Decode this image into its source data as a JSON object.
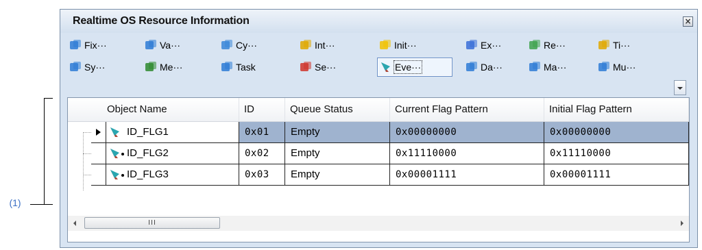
{
  "window": {
    "title": "Realtime OS Resource Information"
  },
  "callout": {
    "label": "(1)"
  },
  "toolbar": {
    "row1": [
      {
        "label": "Fix···",
        "icon": "fixed-memory-pool-icon",
        "color": "#2e7bd6"
      },
      {
        "label": "Va···",
        "icon": "variable-memory-pool-icon",
        "color": "#2e7bd6"
      },
      {
        "label": "Cy···",
        "icon": "cyclic-handler-icon",
        "color": "#3a86d8"
      },
      {
        "label": "Int···",
        "icon": "interrupt-handler-icon",
        "color": "#e0a800"
      },
      {
        "label": "Init···",
        "icon": "initialize-routine-icon",
        "color": "#f2c200"
      },
      {
        "label": "Ex···",
        "icon": "exception-handler-icon",
        "color": "#3a6fd8"
      },
      {
        "label": "Re···",
        "icon": "ready-queue-icon",
        "color": "#3fa34d"
      },
      {
        "label": "Ti···",
        "icon": "timer-queue-icon",
        "color": "#e0a800"
      }
    ],
    "row2": [
      {
        "label": "Sy···",
        "icon": "system-status-icon",
        "color": "#2e7bd6"
      },
      {
        "label": "Me···",
        "icon": "memory-icon",
        "color": "#2f8a2f"
      },
      {
        "label": "Task",
        "icon": "task-icon",
        "color": "#2e7bd6"
      },
      {
        "label": "Se···",
        "icon": "semaphore-icon",
        "color": "#d0342c"
      },
      {
        "label": "Eve···",
        "icon": "eventflag-icon",
        "color": "#1f9f9f"
      },
      {
        "label": "Da···",
        "icon": "data-queue-icon",
        "color": "#2e7bd6"
      },
      {
        "label": "Ma···",
        "icon": "mailbox-icon",
        "color": "#2e7bd6"
      },
      {
        "label": "Mu···",
        "icon": "mutex-icon",
        "color": "#2e7bd6"
      }
    ],
    "active_index": 4
  },
  "table": {
    "columns": [
      "Object Name",
      "ID",
      "Queue Status",
      "Current Flag Pattern",
      "Initial Flag Pattern"
    ],
    "rows": [
      {
        "name": "ID_FLG1",
        "id": "0x01",
        "queue": "Empty",
        "current": "0x00000000",
        "initial": "0x00000000",
        "selected": true
      },
      {
        "name": "ID_FLG2",
        "id": "0x02",
        "queue": "Empty",
        "current": "0x11110000",
        "initial": "0x11110000",
        "selected": false
      },
      {
        "name": "ID_FLG3",
        "id": "0x03",
        "queue": "Empty",
        "current": "0x00001111",
        "initial": "0x00001111",
        "selected": false
      }
    ]
  },
  "scrollbar": {
    "thumb_text": "III"
  }
}
